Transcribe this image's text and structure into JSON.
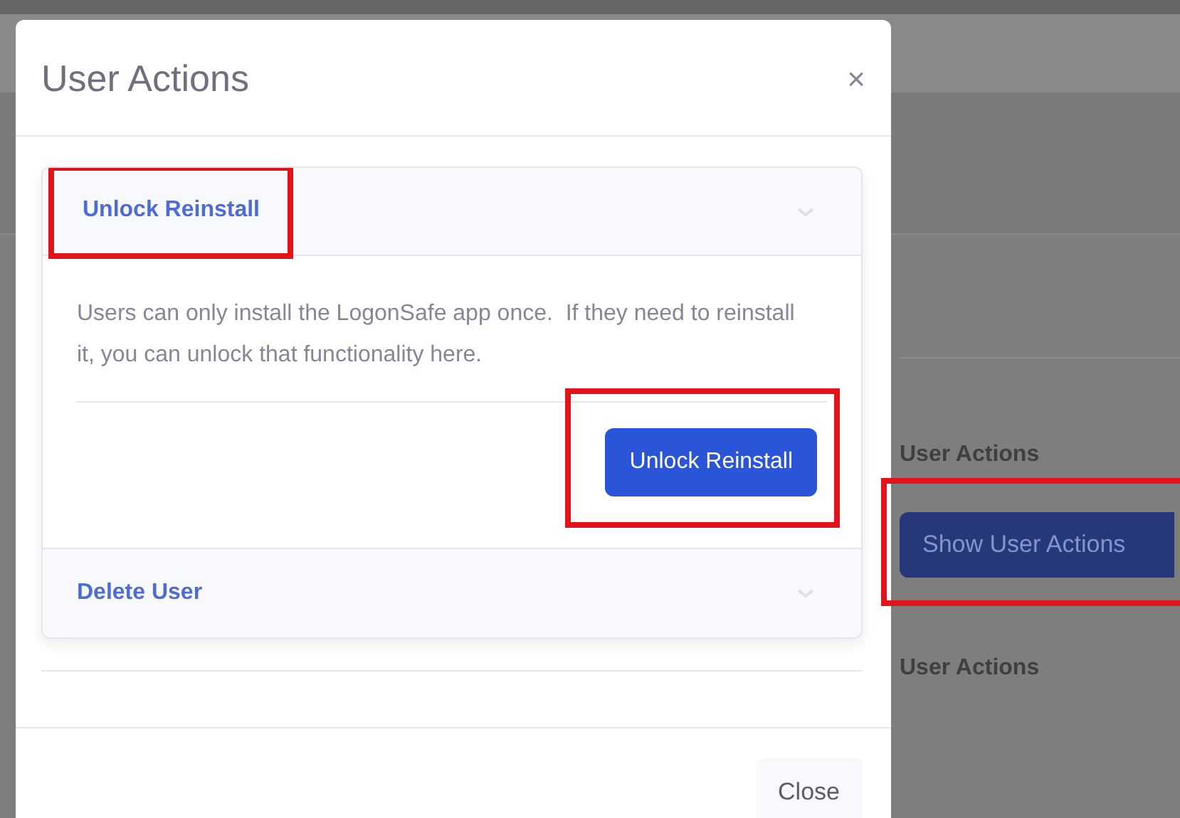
{
  "modal": {
    "title": "User Actions",
    "close_icon": "×",
    "accordion": [
      {
        "title": "Unlock Reinstall",
        "expanded": true,
        "highlighted": true,
        "description": "Users can only install the LogonSafe app once.  If they need to reinstall it, you can unlock that functionality here.",
        "action_button": {
          "label": "Unlock Reinstall",
          "highlighted": true
        }
      },
      {
        "title": "Delete User",
        "expanded": false,
        "highlighted": false
      }
    ],
    "footer_button": "Close"
  },
  "background": {
    "items": [
      {
        "kind": "heading",
        "text": "User Actions"
      },
      {
        "kind": "button",
        "label": "Show User Actions",
        "highlighted": true
      },
      {
        "kind": "heading",
        "text": "User Actions"
      }
    ]
  }
}
